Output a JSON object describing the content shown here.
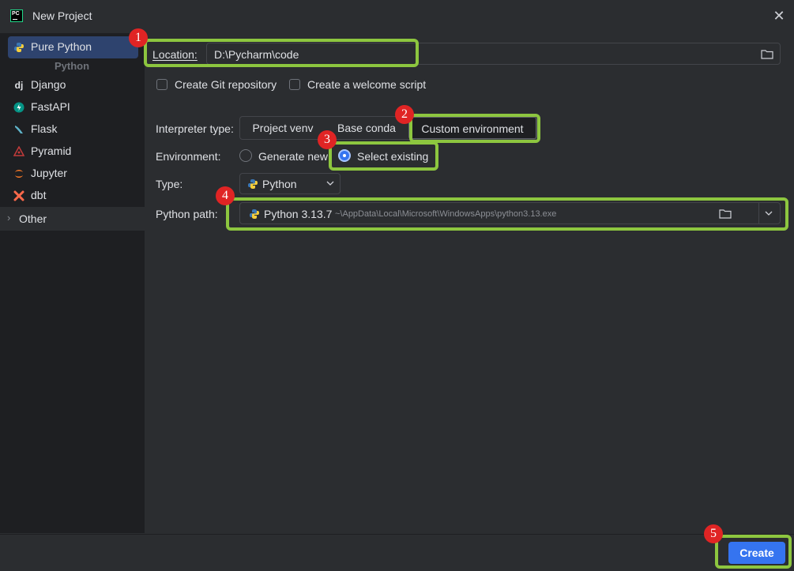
{
  "window": {
    "title": "New Project",
    "close_glyph": "✕"
  },
  "sidebar": {
    "items": [
      {
        "label": "Pure Python",
        "icon": "python-icon",
        "selected": true
      },
      {
        "label": "Django",
        "icon": "django-icon",
        "glyph": "dj"
      },
      {
        "label": "FastAPI",
        "icon": "fastapi-icon"
      },
      {
        "label": "Flask",
        "icon": "flask-icon"
      },
      {
        "label": "Pyramid",
        "icon": "pyramid-icon"
      },
      {
        "label": "Jupyter",
        "icon": "jupyter-icon"
      },
      {
        "label": "dbt",
        "icon": "dbt-icon"
      }
    ],
    "group_label": "Python",
    "other": {
      "label": "Other",
      "chevron": "›"
    }
  },
  "form": {
    "location": {
      "label": "Location:",
      "value": "D:\\Pycharm\\code"
    },
    "git_checkbox": {
      "label": "Create Git repository",
      "checked": false
    },
    "welcome_checkbox": {
      "label": "Create a welcome script",
      "checked": false
    },
    "interpreter": {
      "label": "Interpreter type:",
      "options": [
        "Project venv",
        "Base conda",
        "Custom environment"
      ],
      "selected": "Custom environment"
    },
    "environment": {
      "label": "Environment:",
      "options": [
        "Generate new",
        "Select existing"
      ],
      "selected": "Select existing"
    },
    "type": {
      "label": "Type:",
      "value": "Python"
    },
    "python_path": {
      "label": "Python path:",
      "version": "Python 3.13.7",
      "path": "~\\AppData\\Local\\Microsoft\\WindowsApps\\python3.13.exe"
    }
  },
  "footer": {
    "create_label": "Create"
  },
  "annotations": [
    "1",
    "2",
    "3",
    "4",
    "5"
  ],
  "colors": {
    "accent": "#3574f0",
    "highlight": "#8dc63f",
    "badge": "#e02424"
  }
}
